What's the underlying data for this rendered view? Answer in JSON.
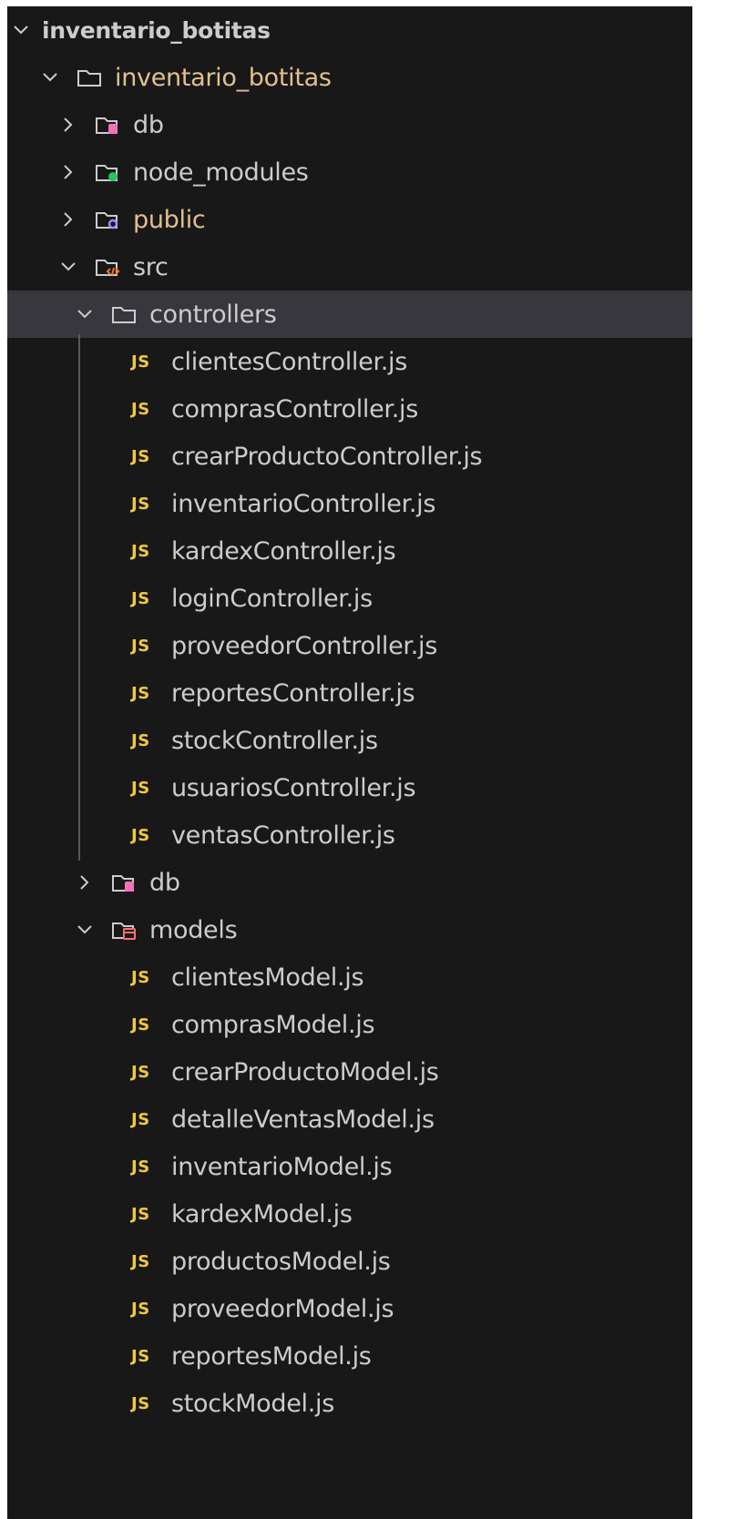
{
  "root": {
    "label": "inventario_botitas"
  },
  "project": {
    "label": "inventario_botitas"
  },
  "top_folders": [
    {
      "label": "db",
      "icon": "db-folder-icon",
      "dot": "#f472b6"
    },
    {
      "label": "node_modules",
      "icon": "node-modules-folder-icon",
      "dot": "#22c55e"
    },
    {
      "label": "public",
      "icon": "public-folder-icon",
      "dot": "#a78bfa"
    }
  ],
  "src": {
    "label": "src"
  },
  "controllers": {
    "label": "controllers",
    "files": [
      "clientesController.js",
      "comprasController.js",
      "crearProductoController.js",
      "inventarioController.js",
      "kardexController.js",
      "loginController.js",
      "proveedorController.js",
      "reportesController.js",
      "stockController.js",
      "usuariosController.js",
      "ventasController.js"
    ]
  },
  "db2": {
    "label": "db"
  },
  "models": {
    "label": "models",
    "files": [
      "clientesModel.js",
      "comprasModel.js",
      "crearProductoModel.js",
      "detalleVentasModel.js",
      "inventarioModel.js",
      "kardexModel.js",
      "productosModel.js",
      "proveedorModel.js",
      "reportesModel.js",
      "stockModel.js"
    ]
  },
  "js_badge": "JS",
  "colors": {
    "bg": "#181818",
    "active_row": "#37373d",
    "js_yellow": "#f0c93a",
    "text": "#cccccc",
    "ignored": "#e2c08d"
  }
}
